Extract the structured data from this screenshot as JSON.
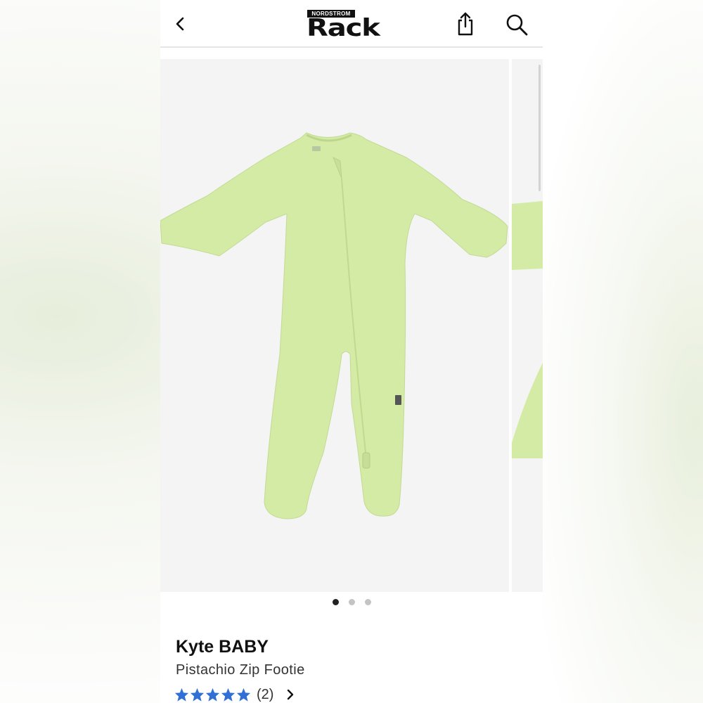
{
  "header": {
    "logo_top": "NORDSTROM",
    "logo_main": "Rack",
    "back_icon": "chevron-left-icon",
    "share_icon": "share-icon",
    "search_icon": "search-icon"
  },
  "gallery": {
    "slide_count": 3,
    "active_index": 0,
    "garment_color": "#d4eba6"
  },
  "product": {
    "brand": "Kyte BABY",
    "name": "Pistachio Zip Footie",
    "rating": 5,
    "review_count": "(2)",
    "star_color": "#2f6fd6"
  }
}
